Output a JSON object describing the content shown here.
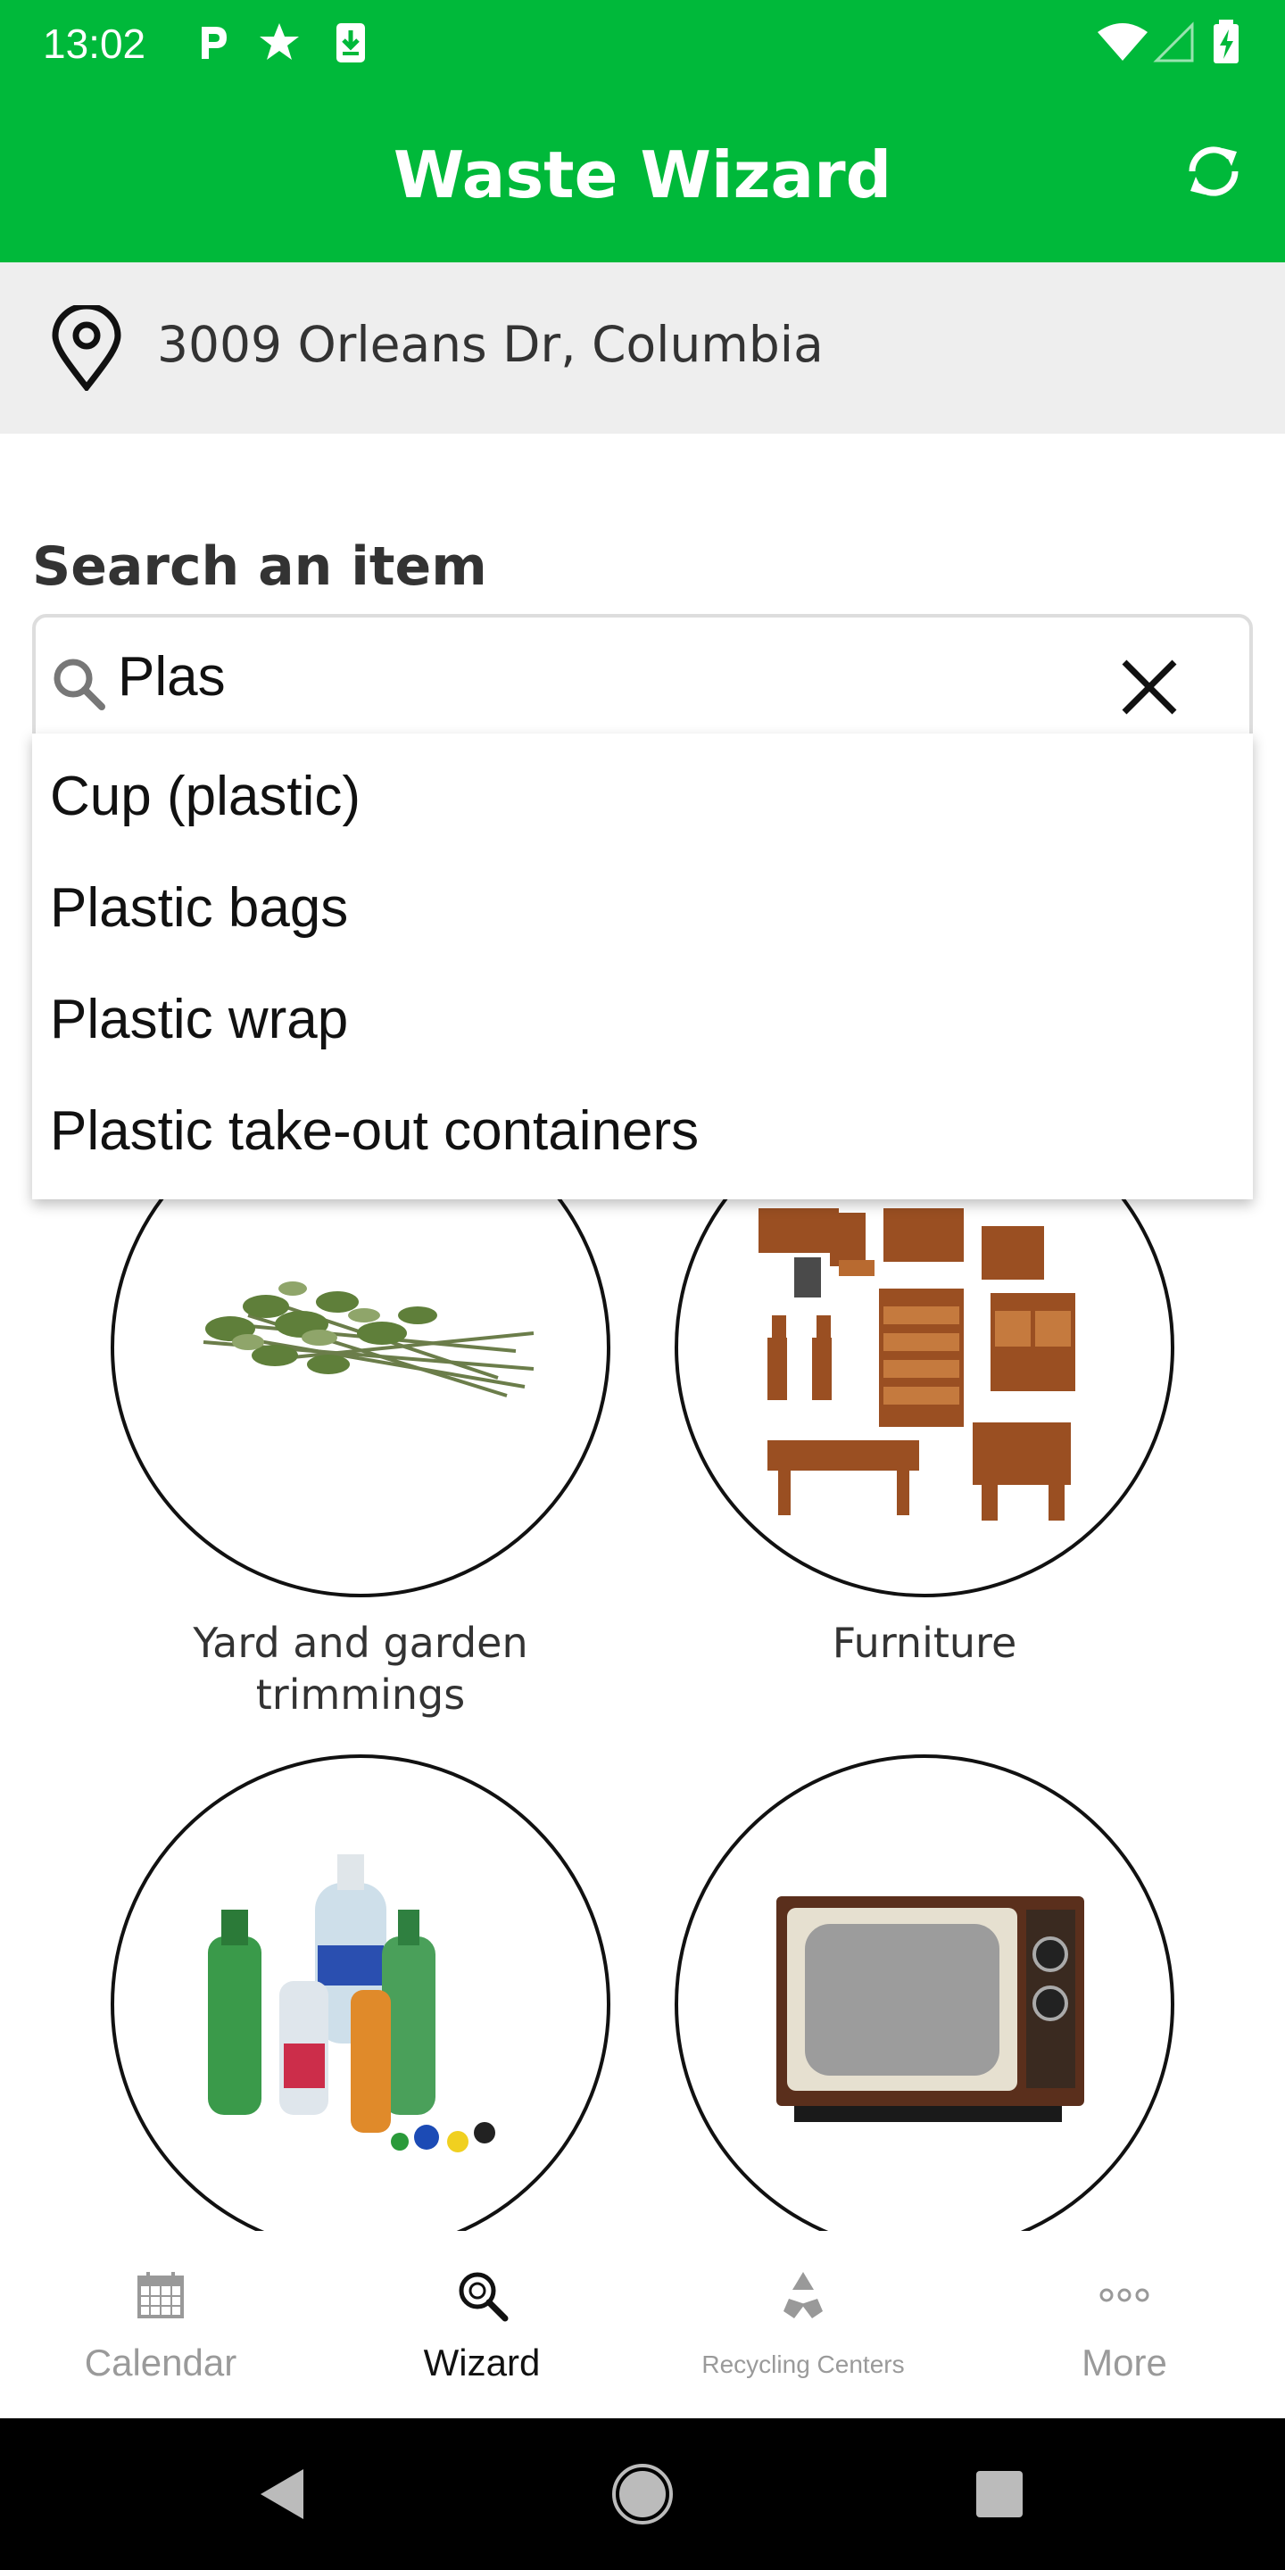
{
  "status_bar": {
    "time": "13:02",
    "icons_left": [
      "parking-icon",
      "star-icon",
      "download-icon"
    ],
    "icons_right": [
      "wifi-icon",
      "cell-signal-icon",
      "battery-charging-icon"
    ]
  },
  "app_bar": {
    "title": "Waste Wizard",
    "background_color": "#00b93a",
    "refresh_icon": "refresh-icon"
  },
  "location": {
    "address": "3009 Orleans Dr, Columbia",
    "icon": "location-pin-icon"
  },
  "search": {
    "label": "Search an item",
    "value": "Plas",
    "suggestions": [
      "Cup (plastic)",
      "Plastic bags",
      "Plastic wrap",
      "Plastic take-out containers"
    ]
  },
  "categories": [
    {
      "label": "Yard and garden trimmings",
      "image": "yard-trimmings-image"
    },
    {
      "label": "Furniture",
      "image": "furniture-image"
    },
    {
      "label": "",
      "image": "plastic-bottles-image"
    },
    {
      "label": "",
      "image": "television-image"
    }
  ],
  "bottom_nav": {
    "tabs": [
      {
        "label": "Calendar",
        "icon": "calendar-icon",
        "active": false
      },
      {
        "label": "Wizard",
        "icon": "wizard-search-icon",
        "active": true
      },
      {
        "label": "Recycling Centers",
        "icon": "recycle-icon",
        "active": false
      },
      {
        "label": "More",
        "icon": "more-dots-icon",
        "active": false
      }
    ]
  },
  "system_nav": {
    "buttons": [
      "back-icon",
      "home-icon",
      "recents-icon"
    ]
  }
}
